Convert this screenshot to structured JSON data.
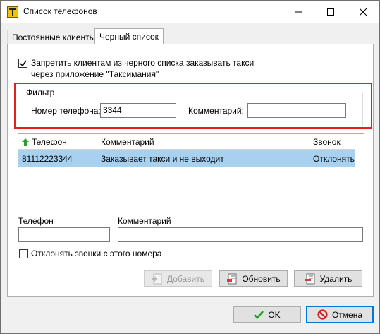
{
  "window": {
    "title": "Список телефонов",
    "app_icon": "taxi-app-icon",
    "controls": [
      "minimize-icon",
      "maximize-icon",
      "close-icon"
    ]
  },
  "tabs": [
    {
      "label": "Постоянные клиенты",
      "active": false
    },
    {
      "label": "Черный список",
      "active": true
    }
  ],
  "blacklist": {
    "block_app_orders": {
      "checked": true,
      "line1": "Запретить клиентам из черного списка заказывать такси",
      "line2": "через приложение \"Таксимания\""
    },
    "filter": {
      "title": "Фильтр",
      "phone_label": "Номер телефона:",
      "phone_value": "3344",
      "comment_label": "Комментарий:",
      "comment_value": ""
    },
    "table": {
      "columns": [
        "Телефон",
        "Комментарий",
        "Звонок"
      ],
      "sort_icon": "sort-up-arrow-icon",
      "rows": [
        {
          "phone": "81112223344",
          "comment": "Заказывает такси и не выходит",
          "call": "Отклонять",
          "selected": true
        }
      ]
    },
    "editor": {
      "phone_label": "Телефон",
      "phone_value": "",
      "comment_label": "Комментарий",
      "comment_value": "",
      "reject_calls": {
        "checked": false,
        "label": "Отклонять звонки с этого номера"
      }
    },
    "actions": {
      "add": {
        "label": "Добавить",
        "enabled": false,
        "icon": "add-icon"
      },
      "update": {
        "label": "Обновить",
        "enabled": true,
        "icon": "update-icon"
      },
      "delete": {
        "label": "Удалить",
        "enabled": true,
        "icon": "delete-icon"
      }
    }
  },
  "footer": {
    "ok": {
      "label": "OK",
      "icon": "check-icon"
    },
    "cancel": {
      "label": "Отмена",
      "icon": "cancel-icon"
    }
  },
  "colors": {
    "highlight_frame": "#e41d1d",
    "selected_row": "#a8d1f0",
    "default_button_border": "#0078d7"
  }
}
